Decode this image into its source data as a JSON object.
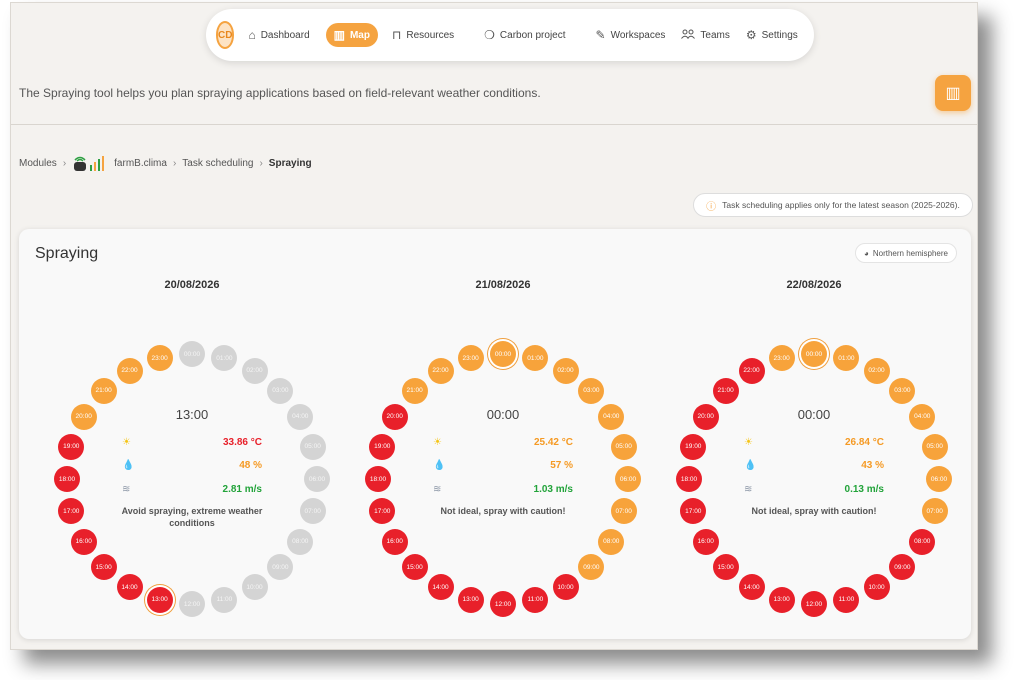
{
  "nav": {
    "avatar": "CD",
    "items": [
      {
        "label": "Dashboard",
        "icon": "home-icon",
        "glyph": "⌂"
      },
      {
        "label": "Map",
        "icon": "map-icon",
        "glyph": "▥",
        "active": true
      },
      {
        "label": "Resources",
        "icon": "building-icon",
        "glyph": "⊓"
      },
      {
        "label": "Carbon project",
        "icon": "leaf-icon",
        "glyph": "❍"
      },
      {
        "label": "Workspaces",
        "icon": "tools-icon",
        "glyph": "✎"
      },
      {
        "label": "Teams",
        "icon": "people-icon",
        "glyph": "👥"
      },
      {
        "label": "Settings",
        "icon": "gear-icon",
        "glyph": "⚙"
      }
    ]
  },
  "intro": "The Spraying tool helps you plan spraying applications based on field-relevant weather conditions.",
  "map_fab_glyph": "▥",
  "breadcrumb": {
    "modules": "Modules",
    "module": "farmB.clima",
    "section": "Task scheduling",
    "current": "Spraying"
  },
  "notice": "Task scheduling applies only for the latest season (2025-2026).",
  "card": {
    "title": "Spraying",
    "hemisphere": "Northern hemisphere"
  },
  "colors": {
    "red": "#e8202a",
    "orange": "#f7a33b",
    "grey": "#d4d4d4",
    "temp_red": "#e8202a",
    "orange_text": "#f59a24",
    "green": "#22a33a",
    "accent": "#f5a340"
  },
  "days": [
    {
      "date": "20/08/2026",
      "time": "13:00",
      "temperature": "33.86 °C",
      "humidity": "48 %",
      "wind": "2.81 m/s",
      "temp_color": "#e8202a",
      "hum_color": "#f59a24",
      "wind_color": "#22a33a",
      "verdict": "Avoid spraying, extreme weather conditions",
      "selected": "13:00",
      "hours": {
        "00:00": "grey",
        "01:00": "grey",
        "02:00": "grey",
        "03:00": "grey",
        "04:00": "grey",
        "05:00": "grey",
        "06:00": "grey",
        "07:00": "grey",
        "08:00": "grey",
        "09:00": "grey",
        "10:00": "grey",
        "11:00": "grey",
        "12:00": "grey",
        "13:00": "red",
        "14:00": "red",
        "15:00": "red",
        "16:00": "red",
        "17:00": "red",
        "18:00": "red",
        "19:00": "red",
        "20:00": "orange",
        "21:00": "orange",
        "22:00": "orange",
        "23:00": "orange"
      }
    },
    {
      "date": "21/08/2026",
      "time": "00:00",
      "temperature": "25.42 °C",
      "humidity": "57 %",
      "wind": "1.03 m/s",
      "temp_color": "#f59a24",
      "hum_color": "#f59a24",
      "wind_color": "#22a33a",
      "verdict": "Not ideal, spray with caution!",
      "selected": "00:00",
      "hours": {
        "00:00": "orange",
        "01:00": "orange",
        "02:00": "orange",
        "03:00": "orange",
        "04:00": "orange",
        "05:00": "orange",
        "06:00": "orange",
        "07:00": "orange",
        "08:00": "orange",
        "09:00": "orange",
        "10:00": "red",
        "11:00": "red",
        "12:00": "red",
        "13:00": "red",
        "14:00": "red",
        "15:00": "red",
        "16:00": "red",
        "17:00": "red",
        "18:00": "red",
        "19:00": "red",
        "20:00": "red",
        "21:00": "orange",
        "22:00": "orange",
        "23:00": "orange"
      }
    },
    {
      "date": "22/08/2026",
      "time": "00:00",
      "temperature": "26.84 °C",
      "humidity": "43 %",
      "wind": "0.13 m/s",
      "temp_color": "#f59a24",
      "hum_color": "#f59a24",
      "wind_color": "#22a33a",
      "verdict": "Not ideal, spray with caution!",
      "selected": "00:00",
      "hours": {
        "00:00": "orange",
        "01:00": "orange",
        "02:00": "orange",
        "03:00": "orange",
        "04:00": "orange",
        "05:00": "orange",
        "06:00": "orange",
        "07:00": "orange",
        "08:00": "red",
        "09:00": "red",
        "10:00": "red",
        "11:00": "red",
        "12:00": "red",
        "13:00": "red",
        "14:00": "red",
        "15:00": "red",
        "16:00": "red",
        "17:00": "red",
        "18:00": "red",
        "19:00": "red",
        "20:00": "red",
        "21:00": "red",
        "22:00": "red",
        "23:00": "orange"
      }
    }
  ]
}
